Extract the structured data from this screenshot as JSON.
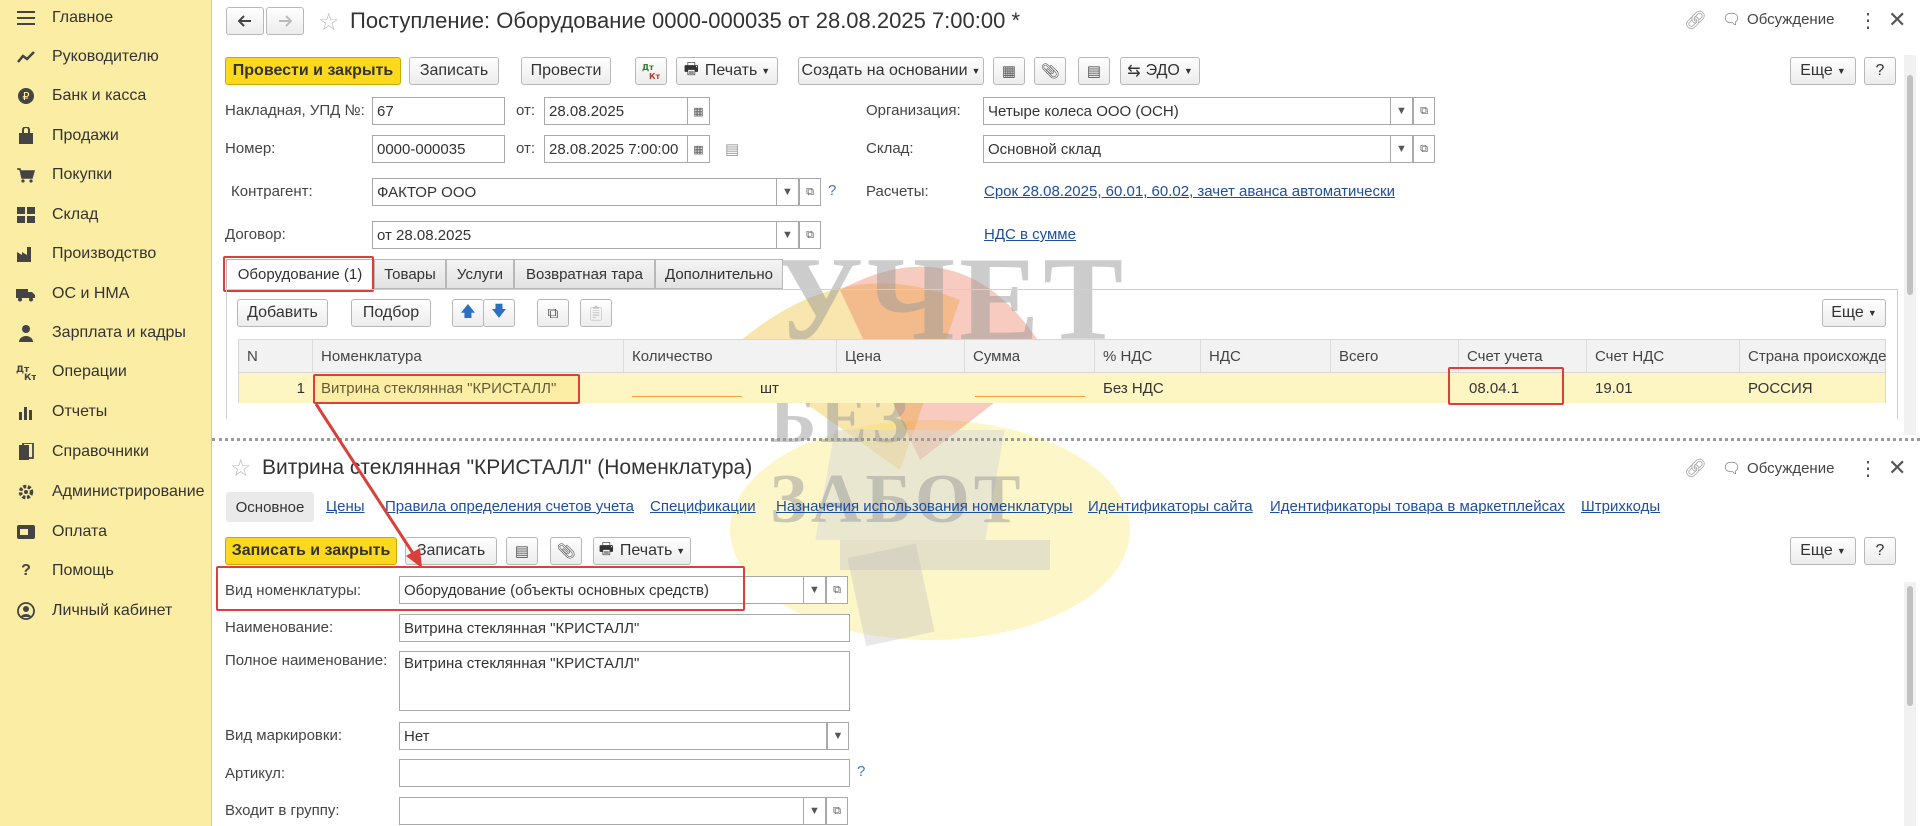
{
  "sidebar": {
    "items": [
      {
        "label": "Главное",
        "icon": "menu-icon"
      },
      {
        "label": "Руководителю",
        "icon": "trend-icon"
      },
      {
        "label": "Банк и касса",
        "icon": "ruble-icon"
      },
      {
        "label": "Продажи",
        "icon": "bag-icon"
      },
      {
        "label": "Покупки",
        "icon": "cart-icon"
      },
      {
        "label": "Склад",
        "icon": "grid-icon"
      },
      {
        "label": "Производство",
        "icon": "factory-icon"
      },
      {
        "label": "ОС и НМА",
        "icon": "truck-icon"
      },
      {
        "label": "Зарплата и кадры",
        "icon": "person-icon"
      },
      {
        "label": "Операции",
        "icon": "dt-kt-icon"
      },
      {
        "label": "Отчеты",
        "icon": "bar-chart-icon"
      },
      {
        "label": "Справочники",
        "icon": "books-icon"
      },
      {
        "label": "Администрирование",
        "icon": "gear-icon"
      },
      {
        "label": "Оплата",
        "icon": "card-icon"
      },
      {
        "label": "Помощь",
        "icon": "question-icon"
      },
      {
        "label": "Личный кабинет",
        "icon": "user-circle-icon"
      }
    ]
  },
  "doc": {
    "title": "Поступление: Оборудование 0000-000035 от 28.08.2025 7:00:00 *",
    "discussion": "Обсуждение",
    "toolbar": {
      "post_close": "Провести и закрыть",
      "save": "Записать",
      "post": "Провести",
      "dtkt": "Дт Кт",
      "print": "Печать",
      "create_based": "Создать на основании",
      "edo": "ЭДО",
      "more": "Еще",
      "help": "?"
    },
    "fields": {
      "invoice_label": "Накладная, УПД №:",
      "invoice_no": "67",
      "from_label": "от:",
      "invoice_date": "28.08.2025",
      "number_label": "Номер:",
      "number": "0000-000035",
      "number_date": "28.08.2025  7:00:00",
      "org_label": "Организация:",
      "org": "Четыре колеса ООО (ОСН)",
      "warehouse_label": "Склад:",
      "warehouse": "Основной склад",
      "counterparty_label": "Контрагент:",
      "counterparty": "ФАКТОР ООО",
      "settlements_label": "Расчеты:",
      "settlements_link": "Срок 28.08.2025, 60.01, 60.02, зачет аванса автоматически",
      "contract_label": "Договор:",
      "contract": "от 28.08.2025",
      "vat_link": "НДС в сумме"
    },
    "tabs": [
      "Оборудование (1)",
      "Товары",
      "Услуги",
      "Возвратная тара",
      "Дополнительно"
    ],
    "table_toolbar": {
      "add": "Добавить",
      "pick": "Подбор",
      "more": "Еще"
    },
    "table": {
      "headers": [
        "N",
        "Номенклатура",
        "Количество",
        "Цена",
        "Сумма",
        "% НДС",
        "НДС",
        "Всего",
        "Счет учета",
        "Счет НДС",
        "Страна происхожде"
      ],
      "row": {
        "n": "1",
        "item": "Витрина стеклянная \"КРИСТАЛЛ\"",
        "qty": "",
        "unit": "шт",
        "price": "",
        "sum": "",
        "vat_rate": "Без НДС",
        "vat": "",
        "total": "",
        "account": "08.04.1",
        "vat_account": "19.01",
        "country": "РОССИЯ"
      }
    }
  },
  "item": {
    "title": "Витрина стеклянная \"КРИСТАЛЛ\" (Номенклатура)",
    "discussion": "Обсуждение",
    "links": [
      "Основное",
      "Цены",
      "Правила определения счетов учета",
      "Спецификации",
      "Назначения использования номенклатуры",
      "Идентификаторы сайта",
      "Идентификаторы товара в маркетплейсах",
      "Штрихкоды"
    ],
    "toolbar": {
      "save_close": "Записать и закрыть",
      "save": "Записать",
      "print": "Печать",
      "more": "Еще",
      "help": "?"
    },
    "fields": {
      "kind_label": "Вид номенклатуры:",
      "kind": "Оборудование (объекты основных средств)",
      "name_label": "Наименование:",
      "name": "Витрина стеклянная \"КРИСТАЛЛ\"",
      "full_name_label": "Полное наименование:",
      "full_name": "Витрина стеклянная \"КРИСТАЛЛ\"",
      "marking_label": "Вид маркировки:",
      "marking": "Нет",
      "article_label": "Артикул:",
      "article": "",
      "group_label": "Входит в группу:",
      "group": ""
    }
  },
  "watermark": {
    "line1": "УЧЕТ",
    "line2": "БЕЗ ЗАБОТ"
  },
  "colors": {
    "sidebar": "#fbeda4",
    "primary": "#fcd91c",
    "highlight": "#d9403a",
    "link": "#1f4e9c",
    "selected_row": "#fdf5c2"
  }
}
